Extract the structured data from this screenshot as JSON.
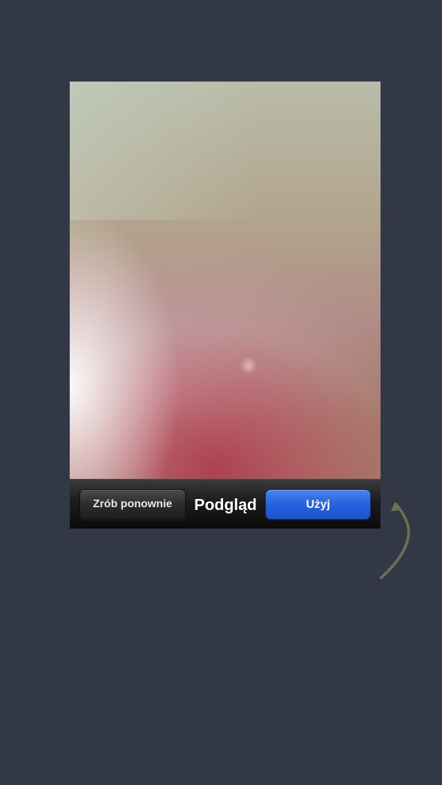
{
  "preview": {
    "retake_label": "Zrób ponownie",
    "title": "Podgląd",
    "use_label": "Użyj"
  },
  "colors": {
    "background": "#323845",
    "use_button": "#2563de",
    "hint_arrow": "#6f6f4e"
  },
  "icons": {
    "hint_arrow": "curved-arrow-icon"
  }
}
